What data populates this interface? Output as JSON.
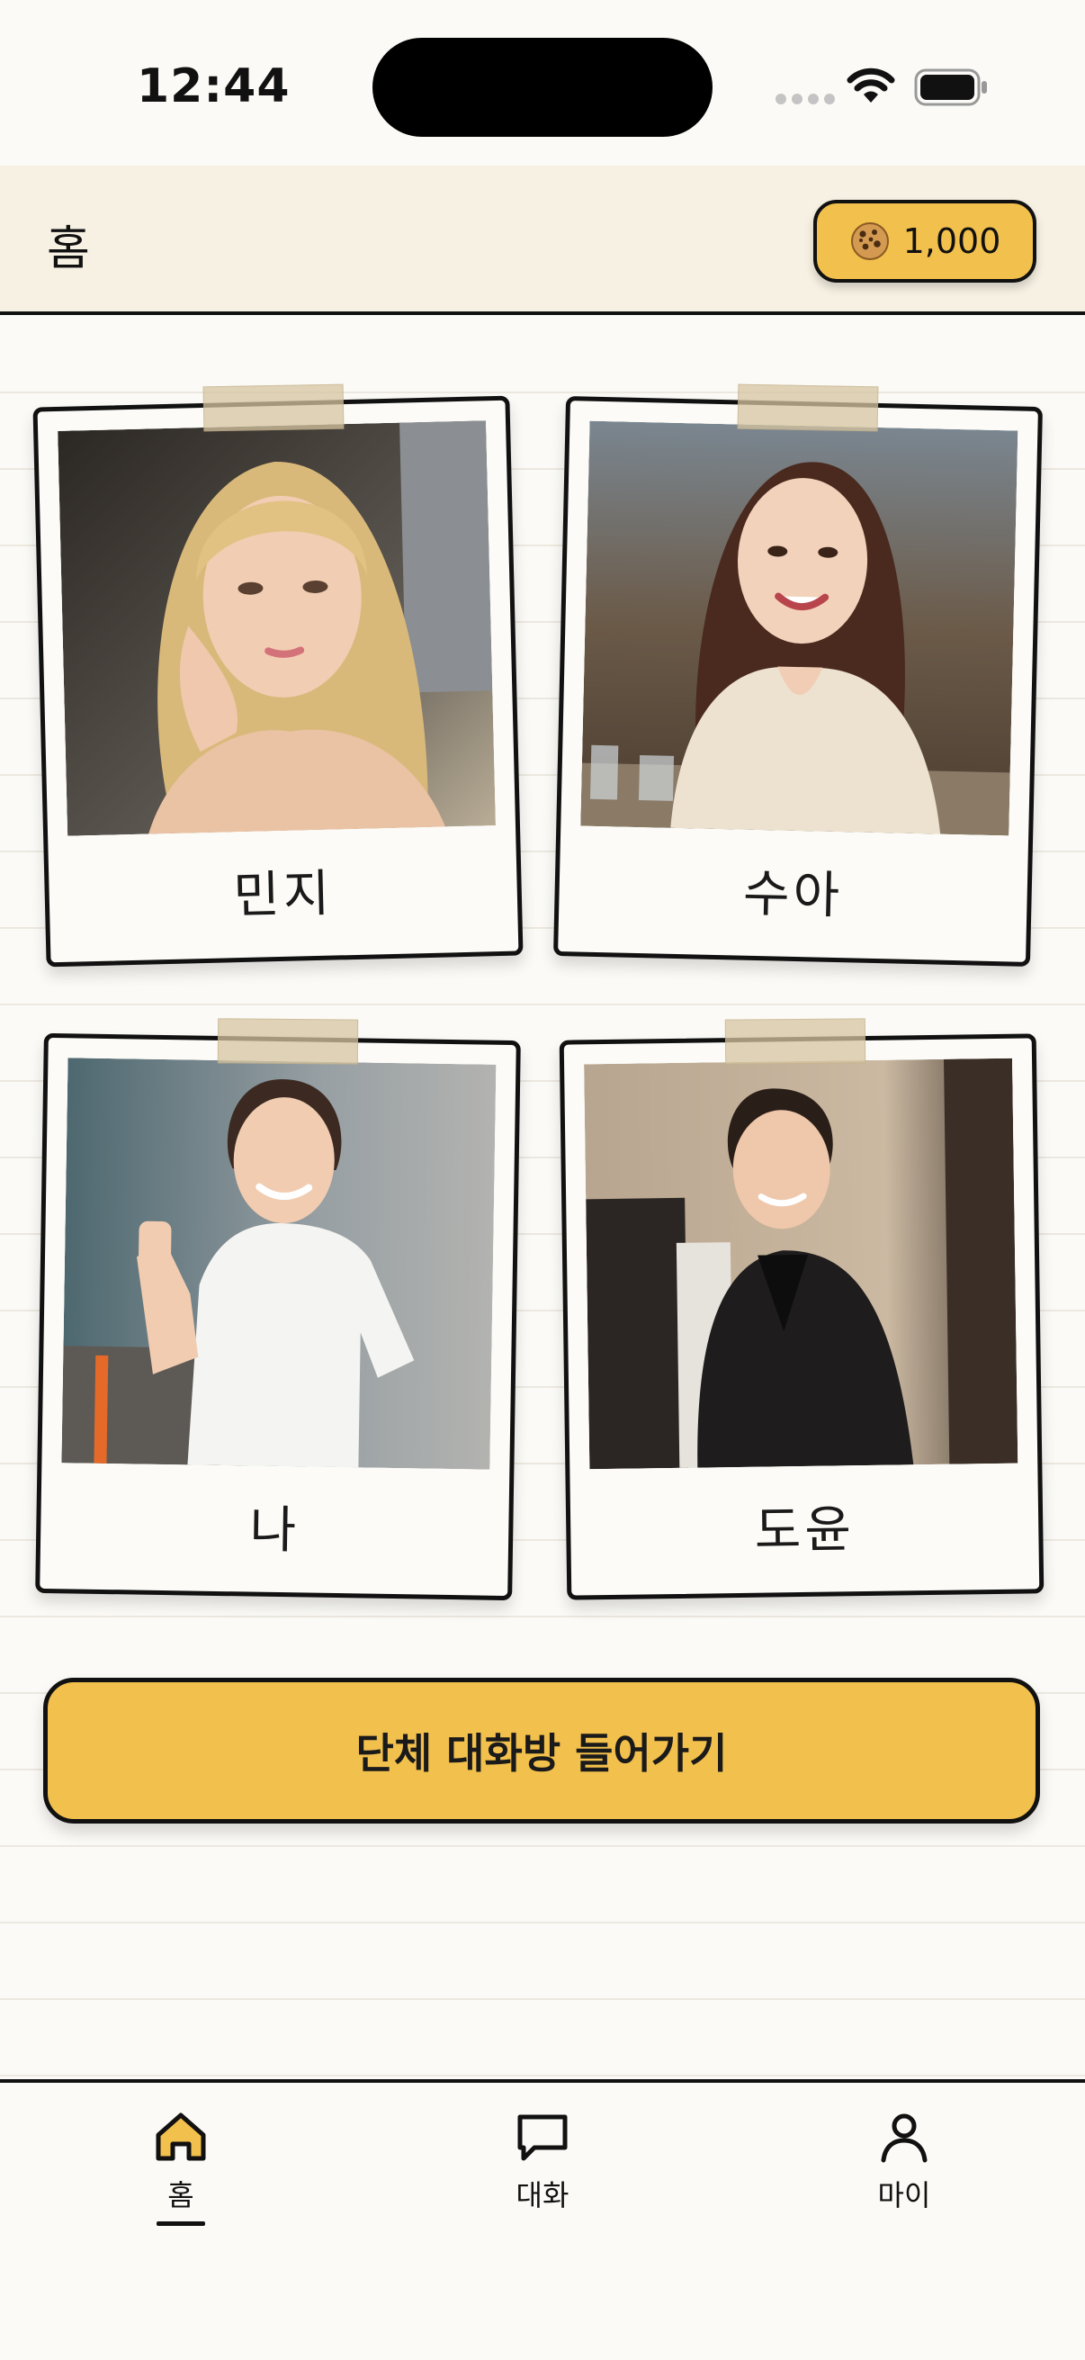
{
  "status_bar": {
    "time": "12:44",
    "icons": [
      "cellular-signal-icon",
      "wifi-icon",
      "battery-icon"
    ]
  },
  "header": {
    "title": "홈",
    "cookie_icon": "cookie-icon",
    "cookie_count": "1,000"
  },
  "characters": [
    {
      "name": "민지"
    },
    {
      "name": "수아"
    },
    {
      "name": "나"
    },
    {
      "name": "도윤"
    }
  ],
  "group_chat_button": {
    "label": "단체 대화방 들어가기"
  },
  "tab_bar": {
    "tabs": [
      {
        "label": "홈",
        "icon": "home-icon",
        "active": true
      },
      {
        "label": "대화",
        "icon": "chat-bubble-icon",
        "active": false
      },
      {
        "label": "마이",
        "icon": "person-icon",
        "active": false
      }
    ]
  },
  "colors": {
    "accent": "#f2c04c",
    "background": "#fbfaf6",
    "header_background": "#f7f1e3",
    "outline": "#111111"
  }
}
